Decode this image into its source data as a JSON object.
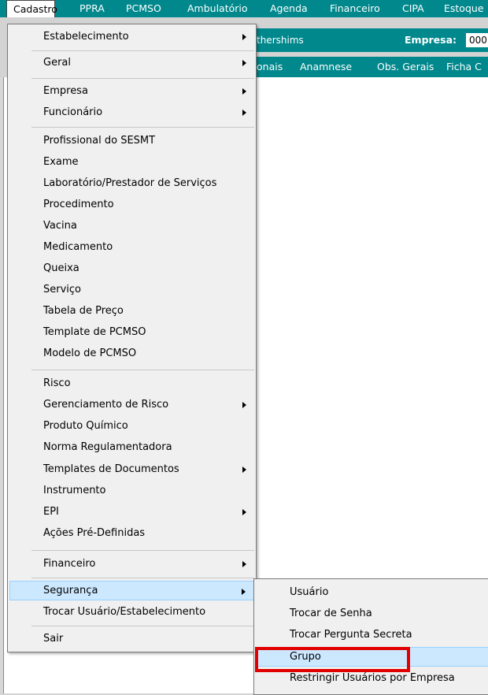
{
  "menubar": {
    "items": [
      "Cadastro",
      "PPRA",
      "PCMSO",
      "Ambulatório",
      "Agenda",
      "Financeiro",
      "CIPA",
      "Estoque"
    ]
  },
  "infobar": {
    "user": "thershims",
    "empresa_label": "Empresa:",
    "empresa_code": "000"
  },
  "tabs": [
    "onais",
    "Anamnese",
    "Obs. Gerais",
    "Ficha C"
  ],
  "cadastro_menu": {
    "items": [
      "Estabelecimento",
      "Geral",
      "Empresa",
      "Funcionário",
      "Profissional do SESMT",
      "Exame",
      "Laboratório/Prestador de Serviços",
      "Procedimento",
      "Vacina",
      "Medicamento",
      "Queixa",
      "Serviço",
      "Tabela de Preço",
      "Template de PCMSO",
      "Modelo de PCMSO",
      "Risco",
      "Gerenciamento de Risco",
      "Produto Químico",
      "Norma Regulamentadora",
      "Templates de Documentos",
      "Instrumento",
      "EPI",
      "Ações Pré-Definidas",
      "Financeiro",
      "Segurança",
      "Trocar Usuário/Estabelecimento",
      "Sair"
    ]
  },
  "seguranca_menu": {
    "items": [
      "Usuário",
      "Trocar de Senha",
      "Trocar Pergunta Secreta",
      "Grupo",
      "Restringir Usuários por Empresa"
    ]
  },
  "colors": {
    "accent": "#00888c",
    "highlight": "#cce8ff",
    "annotation": "#e00000"
  }
}
